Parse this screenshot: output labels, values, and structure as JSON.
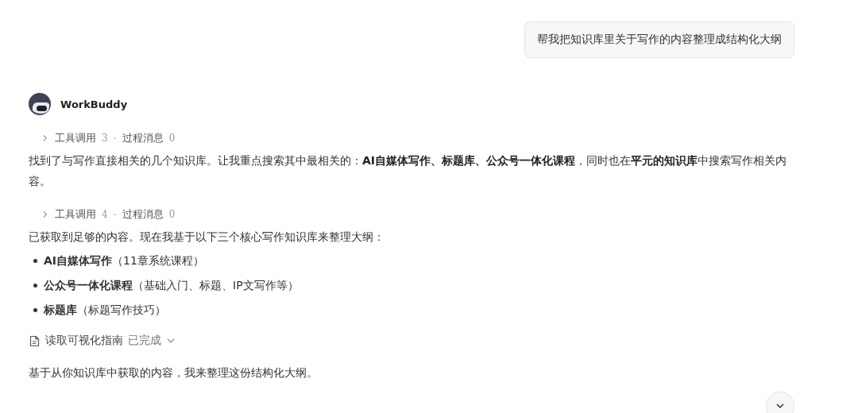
{
  "user_message": {
    "text": "帮我把知识库里关于写作的内容整理成结构化大纲"
  },
  "assistant": {
    "name": "WorkBuddy"
  },
  "blocks": [
    {
      "kind": "tool_summary",
      "tool_label": "工具调用",
      "tool_count": "3",
      "separator": "·",
      "process_label": "过程消息",
      "process_count": "0",
      "expanded": false
    },
    {
      "kind": "paragraph",
      "text": "找到了与写作直接相关的几个知识库。让我重点搜索其中最相关的：**AI自媒体写作、标题库、公众号一体化课程**，同时也在**平元的知识库**中搜索写作相关内容。"
    },
    {
      "kind": "tool_summary",
      "tool_label": "工具调用",
      "tool_count": "4",
      "separator": "·",
      "process_label": "过程消息",
      "process_count": "0",
      "expanded": false
    },
    {
      "kind": "paragraph",
      "text": "已获取到足够的内容。现在我基于以下三个核心写作知识库来整理大纲："
    },
    {
      "kind": "list",
      "items": [
        "**AI自媒体写作**（11章系统课程）",
        "**公众号一体化课程**（基础入门、标题、IP文写作等）",
        "**标题库**（标题写作技巧）"
      ]
    },
    {
      "kind": "task",
      "title": "读取可视化指南",
      "status": "已完成",
      "expanded": false
    },
    {
      "kind": "paragraph",
      "text": "基于从你知识库中获取的内容，我来整理这份结构化大纲。"
    }
  ]
}
